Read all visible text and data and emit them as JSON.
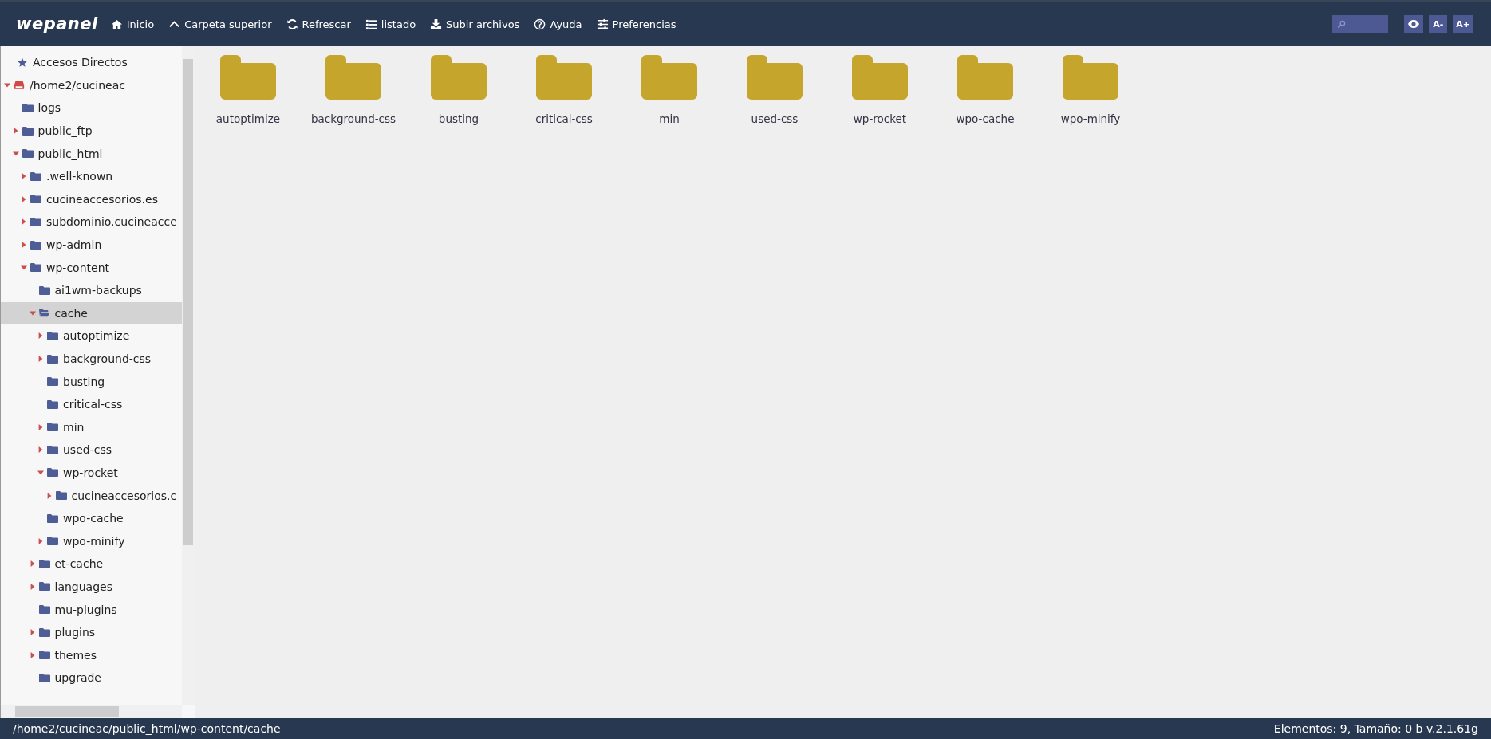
{
  "app": {
    "logo": "wepanel"
  },
  "toolbar": [
    {
      "kind": "home",
      "label": "Inicio"
    },
    {
      "kind": "up",
      "label": "Carpeta superior"
    },
    {
      "kind": "refresh",
      "label": "Refrescar"
    },
    {
      "kind": "list",
      "label": "listado"
    },
    {
      "kind": "upload",
      "label": "Subir archivos"
    },
    {
      "kind": "help",
      "label": "Ayuda"
    },
    {
      "kind": "prefs",
      "label": "Preferencias"
    }
  ],
  "view_buttons": [
    {
      "kind": "eye"
    },
    {
      "kind": "text",
      "label": "A-"
    },
    {
      "kind": "text",
      "label": "A+"
    }
  ],
  "sidebar": {
    "shortcuts": "Accesos Directos",
    "tree": [
      {
        "name": "/home2/cucineac",
        "kind": "drive",
        "expanded": true,
        "selected": false,
        "children": [
          {
            "name": "logs",
            "kind": "folder",
            "selected": false
          },
          {
            "name": "public_ftp",
            "kind": "folder",
            "expanded": false,
            "selected": false
          },
          {
            "name": "public_html",
            "kind": "folder",
            "expanded": true,
            "selected": false,
            "children": [
              {
                "name": ".well-known",
                "kind": "folder",
                "expanded": false,
                "selected": false
              },
              {
                "name": "cucineaccesorios.es",
                "kind": "folder",
                "expanded": false,
                "selected": false
              },
              {
                "name": "subdominio.cucineacce",
                "kind": "folder",
                "expanded": false,
                "selected": false
              },
              {
                "name": "wp-admin",
                "kind": "folder",
                "expanded": false,
                "selected": false
              },
              {
                "name": "wp-content",
                "kind": "folder",
                "expanded": true,
                "selected": false,
                "children": [
                  {
                    "name": "ai1wm-backups",
                    "kind": "folder",
                    "selected": false
                  },
                  {
                    "name": "cache",
                    "kind": "folder",
                    "expanded": true,
                    "selected": true,
                    "children": [
                      {
                        "name": "autoptimize",
                        "kind": "folder",
                        "expanded": false,
                        "selected": false
                      },
                      {
                        "name": "background-css",
                        "kind": "folder",
                        "expanded": false,
                        "selected": false
                      },
                      {
                        "name": "busting",
                        "kind": "folder",
                        "selected": false
                      },
                      {
                        "name": "critical-css",
                        "kind": "folder",
                        "selected": false
                      },
                      {
                        "name": "min",
                        "kind": "folder",
                        "expanded": false,
                        "selected": false
                      },
                      {
                        "name": "used-css",
                        "kind": "folder",
                        "expanded": false,
                        "selected": false
                      },
                      {
                        "name": "wp-rocket",
                        "kind": "folder",
                        "expanded": true,
                        "selected": false,
                        "children": [
                          {
                            "name": "cucineaccesorios.c",
                            "kind": "folder",
                            "expanded": false,
                            "selected": false
                          }
                        ]
                      },
                      {
                        "name": "wpo-cache",
                        "kind": "folder",
                        "selected": false
                      },
                      {
                        "name": "wpo-minify",
                        "kind": "folder",
                        "expanded": false,
                        "selected": false
                      }
                    ]
                  },
                  {
                    "name": "et-cache",
                    "kind": "folder",
                    "expanded": false,
                    "selected": false
                  },
                  {
                    "name": "languages",
                    "kind": "folder",
                    "expanded": false,
                    "selected": false
                  },
                  {
                    "name": "mu-plugins",
                    "kind": "folder",
                    "selected": false
                  },
                  {
                    "name": "plugins",
                    "kind": "folder",
                    "expanded": false,
                    "selected": false
                  },
                  {
                    "name": "themes",
                    "kind": "folder",
                    "expanded": false,
                    "selected": false
                  },
                  {
                    "name": "upgrade",
                    "kind": "folder",
                    "selected": false
                  }
                ]
              }
            ]
          }
        ]
      }
    ]
  },
  "files": [
    {
      "name": "autoptimize"
    },
    {
      "name": "background-css"
    },
    {
      "name": "busting"
    },
    {
      "name": "critical-css"
    },
    {
      "name": "min"
    },
    {
      "name": "used-css"
    },
    {
      "name": "wp-rocket"
    },
    {
      "name": "wpo-cache"
    },
    {
      "name": "wpo-minify"
    }
  ],
  "status_bar": {
    "path": "/home2/cucineac/public_html/wp-content/cache",
    "info": "Elementos: 9, Tamaño: 0 b v.2.1.61g"
  }
}
